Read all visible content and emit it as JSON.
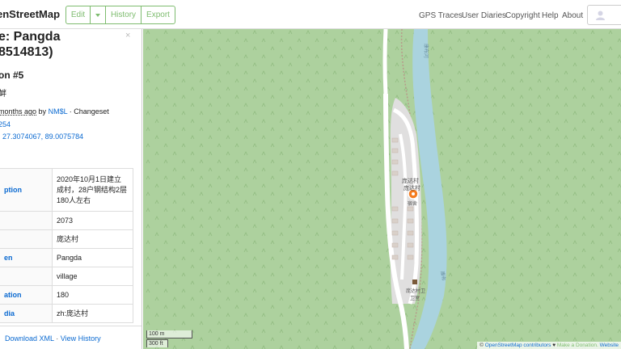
{
  "header": {
    "brand": "enStreetMap",
    "edit": "Edit",
    "history": "History",
    "export": "Export",
    "nav": [
      "GPS Traces",
      "User Diaries",
      "Copyright",
      "Help",
      "About"
    ]
  },
  "sidebar": {
    "title_line1": "e: Pangda",
    "title_line2": "8514813)",
    "close_glyph": "×",
    "version": "on #5",
    "tagline": "衅",
    "edited_ago": "months ago",
    "edited_by_label": "by",
    "user": "NM$L",
    "changeset_label": "· Changeset",
    "changeset_id": "254",
    "location_label": ":",
    "location": "27.3074067, 89.0075784",
    "tags": [
      {
        "key": "ption",
        "value": "2020年10月1日建立成村，28户钢结构2层180人左右"
      },
      {
        "key": "",
        "value": "2073"
      },
      {
        "key": "",
        "value": "庞达村"
      },
      {
        "key": "en",
        "value": "Pangda"
      },
      {
        "key": "",
        "value": "village"
      },
      {
        "key": "ation",
        "value": "180"
      },
      {
        "key": "dia",
        "value": "zh:庞达村"
      }
    ],
    "footer": {
      "download": "Download XML",
      "sep": "·",
      "history": "View History"
    }
  },
  "map": {
    "labels": {
      "place_line1": "庞达村",
      "place_line2": "庞达村",
      "marker_caption": "宿舍",
      "clinic_line1": "庞达村卫",
      "clinic_line2": "卫室",
      "river_top": "康布河",
      "river_mid": "康布"
    },
    "scale_m": "100 m",
    "scale_ft": "300 ft",
    "attribution": {
      "prefix": "©",
      "osm": "OpenStreetMap contributors",
      "heart": "♥",
      "donate": "Make a Donation.",
      "website": "Website"
    }
  },
  "colors": {
    "accent": "#7ebc6f",
    "link": "#0b6ad1",
    "forest": "#add19e",
    "water": "#aad3df",
    "marker": "#f47c20"
  }
}
